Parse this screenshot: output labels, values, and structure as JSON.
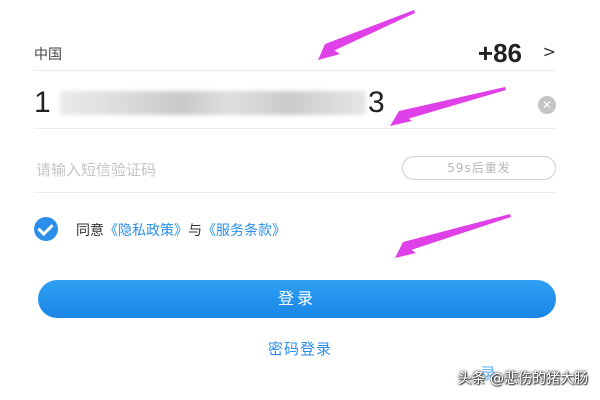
{
  "country": {
    "name": "中国",
    "code": "+86",
    "chevron_icon": "chevron-right-icon"
  },
  "phone": {
    "prefix": "1",
    "suffix": "3",
    "clear_icon": "clear-icon"
  },
  "sms": {
    "placeholder": "请输入短信验证码",
    "resend_label": "59s后重发"
  },
  "agreement": {
    "checked": true,
    "prefix": "同意",
    "privacy_link": "《隐私政策》",
    "conjunction": "与",
    "terms_link": "《服务条款》"
  },
  "login_button": "登录",
  "password_login": "密码登录",
  "partial_text": "录",
  "watermark": "头条 @悲伤的猪大肠",
  "colors": {
    "accent": "#2b8fea",
    "annotation_arrow": "#e040e8"
  }
}
